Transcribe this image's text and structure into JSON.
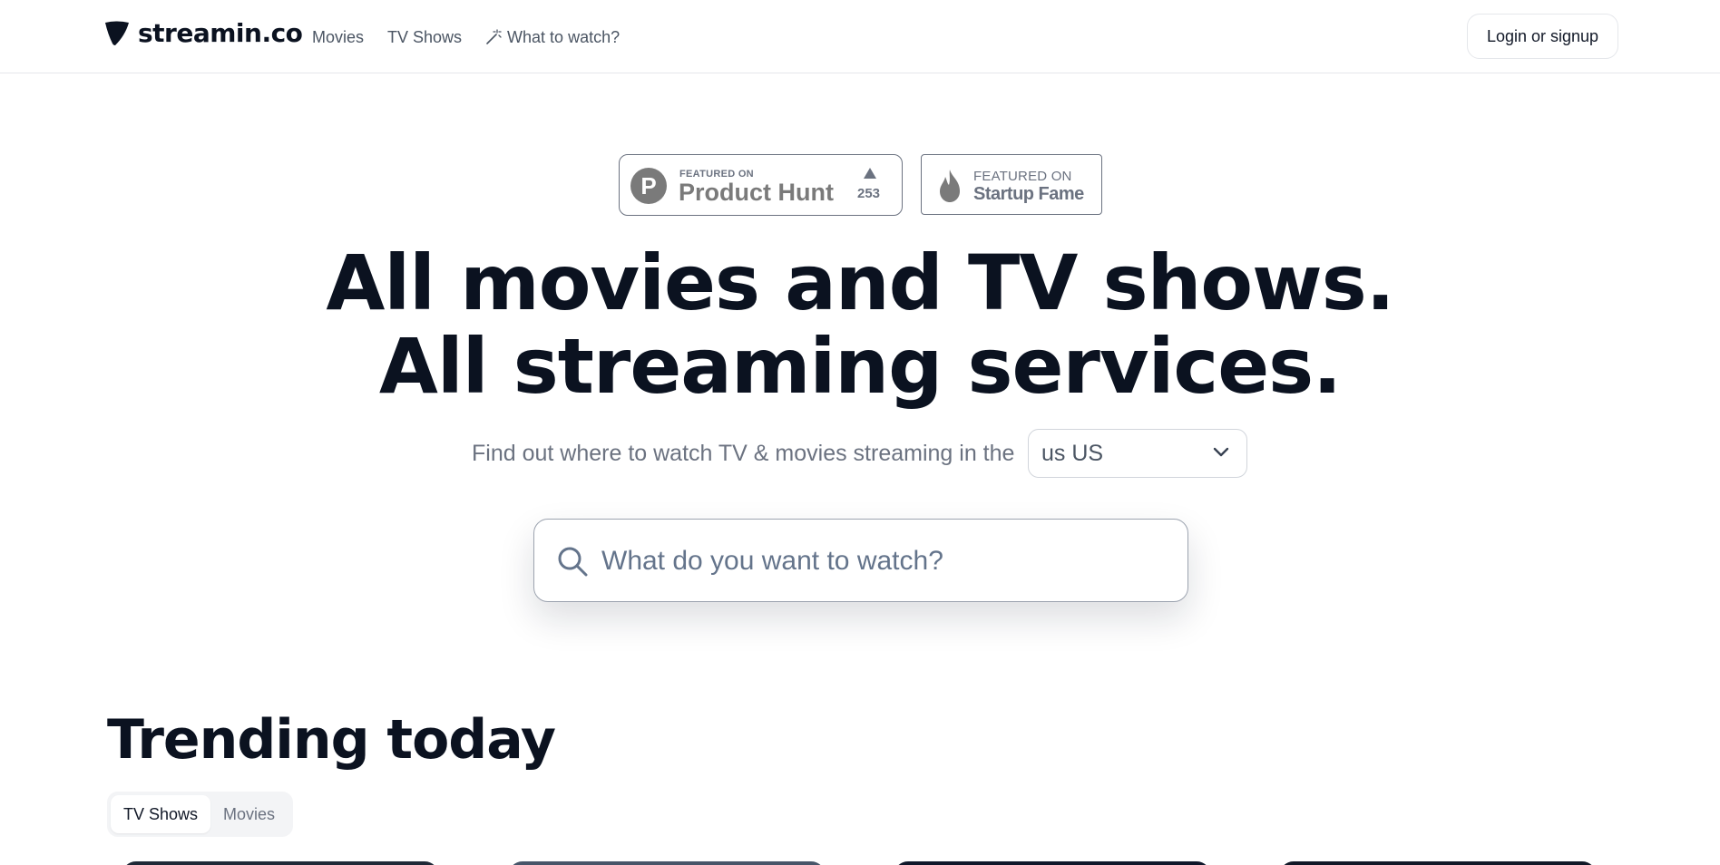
{
  "header": {
    "logo_text": "streamin.co",
    "logo_icon": "triangle-shield-icon",
    "nav": [
      {
        "label": "Movies"
      },
      {
        "label": "TV Shows"
      },
      {
        "label": "What to watch?",
        "icon": "magic-wand-icon"
      }
    ],
    "login_label": "Login or signup"
  },
  "badges": {
    "product_hunt": {
      "small": "FEATURED ON",
      "name": "Product Hunt",
      "count": "253",
      "logo_letter": "P"
    },
    "startup_fame": {
      "small": "FEATURED ON",
      "name": "Startup Fame",
      "icon": "flame-icon"
    }
  },
  "hero": {
    "line1": "All movies and TV shows.",
    "line2": "All streaming services.",
    "subtitle": "Find out where to watch TV & movies streaming in the",
    "country_value": "us US"
  },
  "search": {
    "placeholder": "What do you want to watch?",
    "value": ""
  },
  "trending": {
    "title": "Trending today",
    "tabs": [
      {
        "label": "TV Shows",
        "active": true
      },
      {
        "label": "Movies",
        "active": false
      }
    ]
  },
  "colors": {
    "text_dark": "#0b1220",
    "muted": "#6b7280",
    "border": "#e5e7eb"
  }
}
